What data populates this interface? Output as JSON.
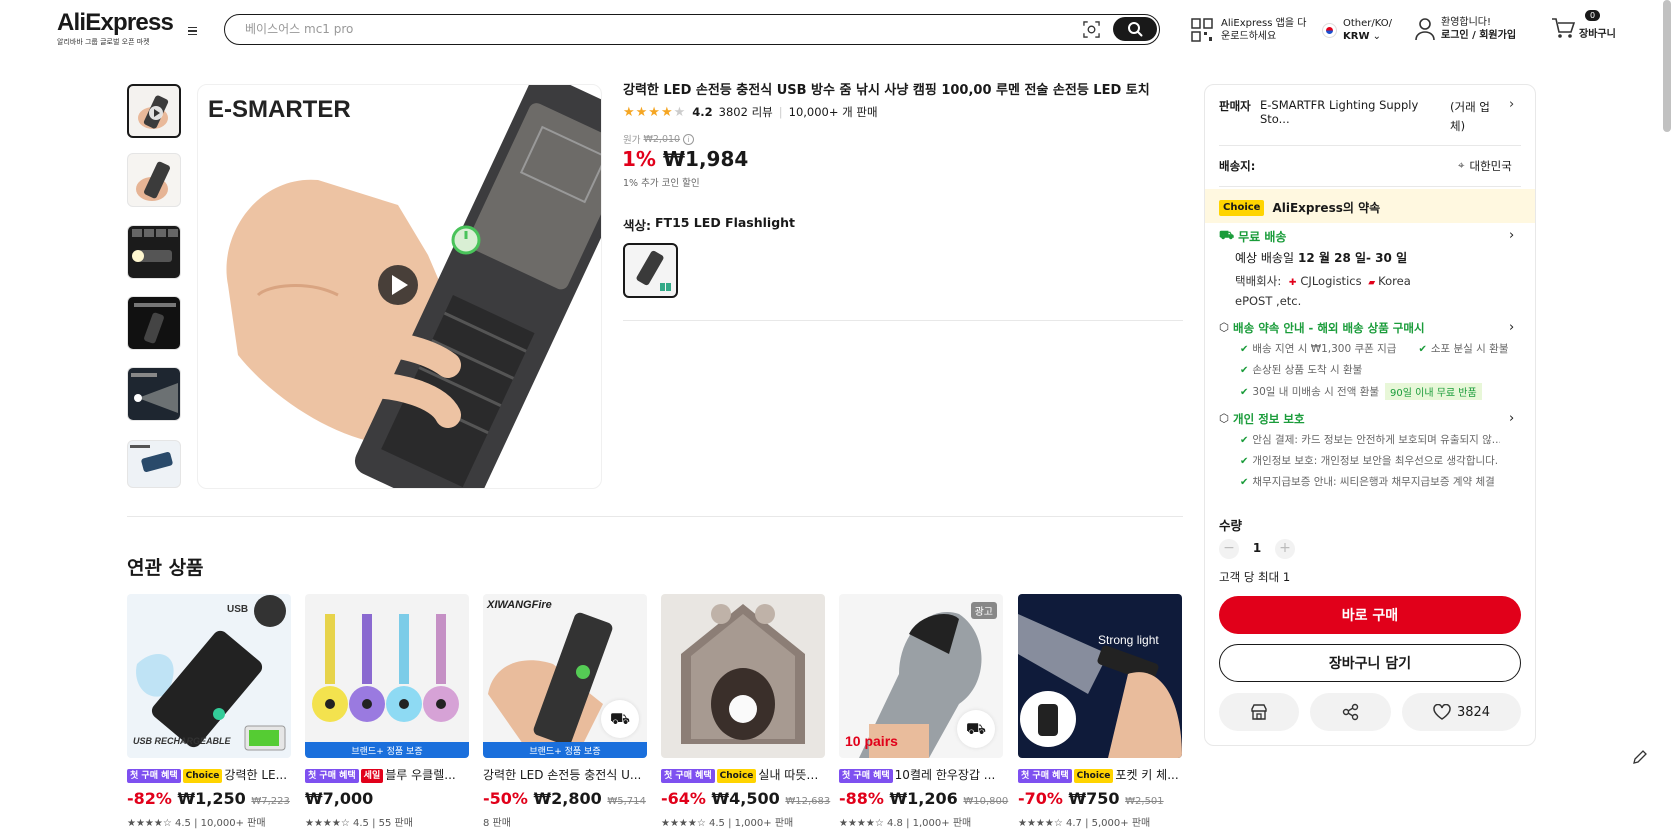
{
  "header": {
    "logo": "AliExpress",
    "logo_sub": "알리바바 그룹 글로벌 오픈 마켓",
    "search_placeholder": "베이스어스 mc1 pro",
    "app_line1": "AliExpress 앱을 다",
    "app_line2": "운로드하세요",
    "region_line1": "Other/KO/",
    "region_line2": "KRW",
    "welcome": "환영합니다!",
    "login": "로그인 / 회원가입",
    "cart_count": "0",
    "cart_label": "장바구니"
  },
  "product": {
    "title": "강력한 LED 손전등 충전식 USB 방수 줌 낚시 사냥 캠핑 100,00 루멘 전술 손전등 LED 토치",
    "rating": "4.2",
    "reviews": "3802 리뷰",
    "sold": "10,000+ 개 판매",
    "original_label": "원가",
    "original_price": "₩2,010",
    "discount": "1%",
    "price": "₩1,984",
    "coin_note": "1% 추가 코인 할인",
    "color_label": "색상:",
    "color_value": "FT15 LED Flashlight",
    "brand_logo": "E-SMARTER"
  },
  "panel": {
    "seller_label": "판매자",
    "seller_name": "E-SMARTFR Lighting Supply Sto...",
    "seller_type": "(거래 업체)",
    "ship_to_label": "배송지:",
    "ship_to": "대한민국",
    "choice_badge": "Choice",
    "promise": "AliExpress의 약속",
    "free_shipping": "무료 배송",
    "delivery_prefix": "예상 배송일",
    "delivery_dates": "12 월 28 일- 30 일",
    "courier_label": "택배회사:",
    "courier1": "CJLogistics",
    "courier2": "Korea",
    "courier3": "ePOST ,etc.",
    "guarantee_title": "배송 약속 안내 - 해외 배송 상품 구매시",
    "guarantee_items": [
      "배송 지연 시 ₩1,300 쿠폰 지급",
      "소포 분실 시 환불",
      "손상된 상품 도착 시 환불",
      "30일 내 미배송 시 전액 환불"
    ],
    "return_badge": "90일 이내 무료 반품",
    "privacy_title": "개인 정보 보호",
    "privacy_items": [
      "안심 결제: 카드 정보는 안전하게 보호되며 유출되지 않...",
      "개인정보 보호: 개인정보 보안을 최우선으로 생각합니다.",
      "채무지급보증 안내: 씨티은행과 채무지급보증 계약 체결"
    ],
    "qty_label": "수량",
    "qty_value": "1",
    "qty_limit": "고객 당 최대 1",
    "buy_now": "바로 구매",
    "add_cart": "장바구니 담기",
    "wish_count": "3824"
  },
  "related": {
    "title": "연관 상품",
    "items": [
      {
        "tag1": "첫 구매 혜택",
        "tag2": "Choice",
        "title": "강력한 LE...",
        "discount": "-82%",
        "price": "₩1,250",
        "original": "₩7,223",
        "meta": "★★★★☆ 4.5 | 10,000+ 판매",
        "img_text": "USB RECHARGEABLE"
      },
      {
        "tag1": "첫 구매 혜택",
        "tag2": "세일",
        "title": "블루 우클렐...",
        "discount": "",
        "price": "₩7,000",
        "original": "",
        "meta": "★★★★☆ 4.5 | 55 판매",
        "brand": "브랜드+ 정품 보증"
      },
      {
        "tag1": "",
        "tag2": "",
        "title": "강력한 LED 손전등 충전식 U...",
        "discount": "-50%",
        "price": "₩2,800",
        "original": "₩5,714",
        "meta": "8 판매",
        "brand": "브랜드+ 정품 보증",
        "img_text": "XIWANGFire"
      },
      {
        "tag1": "첫 구매 혜택",
        "tag2": "Choice",
        "title": "실내 따뜻한...",
        "discount": "-64%",
        "price": "₩4,500",
        "original": "₩12,683",
        "meta": "★★★★☆ 4.5 | 1,000+ 판매"
      },
      {
        "tag1": "첫 구매 혜택",
        "tag2": "",
        "title": "10켤레 한우장갑 ...",
        "discount": "-88%",
        "price": "₩1,206",
        "original": "₩10,800",
        "meta": "★★★★☆ 4.8 | 1,000+ 판매",
        "ad": "광고",
        "img_text": "10 pairs"
      },
      {
        "tag1": "첫 구매 혜택",
        "tag2": "Choice",
        "title": "포켓 키 체...",
        "discount": "-70%",
        "price": "₩750",
        "original": "₩2,501",
        "meta": "★★★★☆ 4.7 | 5,000+ 판매",
        "img_text": "Strong light"
      }
    ]
  }
}
